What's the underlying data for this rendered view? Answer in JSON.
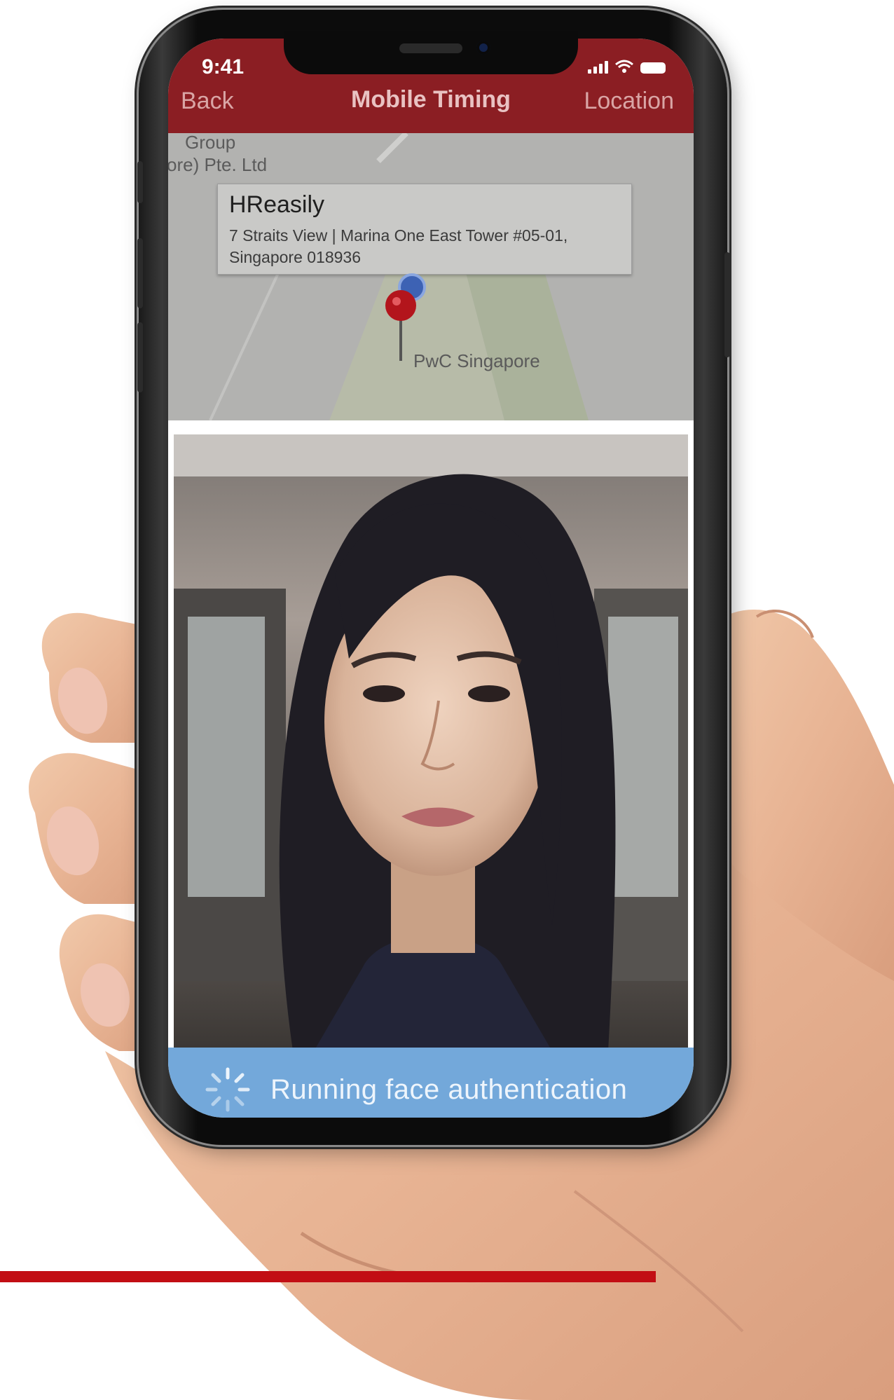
{
  "status_bar": {
    "time": "9:41"
  },
  "nav": {
    "back_label": "Back",
    "title": "Mobile Timing",
    "right_label": "Location"
  },
  "map": {
    "partial_label_1": "Group",
    "partial_label_2": "ore) Pte. Ltd",
    "callout_title": "HReasily",
    "callout_address": "7 Straits View | Marina One East Tower #05-01, Singapore 018936",
    "pin_label": "PwC Singapore"
  },
  "auth": {
    "status_text": "Running face authentication"
  },
  "colors": {
    "header": "#8b1e23",
    "banner": "#73a8da",
    "rule": "#c20e14"
  }
}
